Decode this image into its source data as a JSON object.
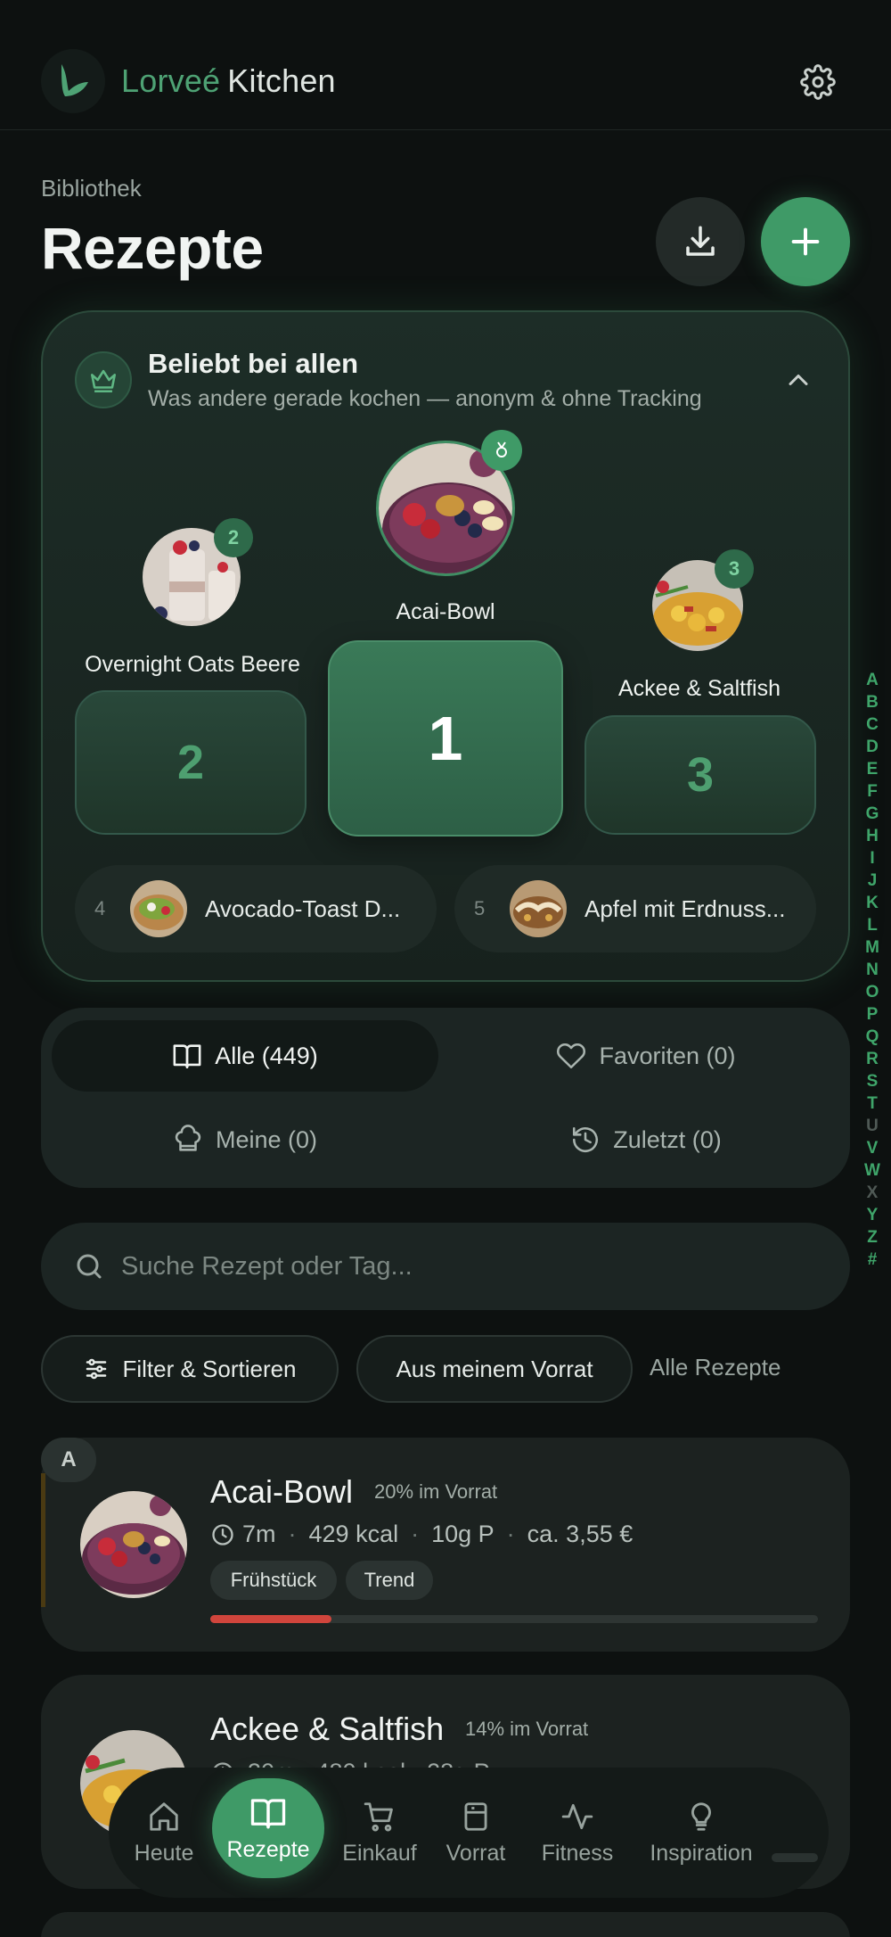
{
  "header": {
    "brand_part1": "Lorveé",
    "brand_part2": "Kitchen",
    "icons": {
      "logo": "leaf-logo-icon",
      "settings": "gear-icon"
    }
  },
  "page": {
    "eyebrow": "Bibliothek",
    "title": "Rezepte",
    "actions": {
      "download": "download-icon",
      "add": "plus-icon"
    }
  },
  "popular": {
    "title": "Beliebt bei allen",
    "subtitle": "Was andere gerade kochen — anonym & ohne Tracking",
    "podium": [
      {
        "rank": "1",
        "name": "Acai-Bowl"
      },
      {
        "rank": "2",
        "name": "Overnight Oats Beere"
      },
      {
        "rank": "3",
        "name": "Ackee & Saltfish"
      }
    ],
    "more": [
      {
        "rank": "4",
        "name": "Avocado-Toast D..."
      },
      {
        "rank": "5",
        "name": "Apfel mit Erdnuss..."
      }
    ]
  },
  "tabs": {
    "all": "Alle (449)",
    "favorites": "Favoriten (0)",
    "mine": "Meine (0)",
    "recent": "Zuletzt (0)"
  },
  "search": {
    "placeholder": "Suche Rezept oder Tag..."
  },
  "filters": {
    "filter_sort": "Filter & Sortieren",
    "from_stock": "Aus meinem Vorrat",
    "all_recipes": "Alle Rezepte"
  },
  "recipes": [
    {
      "letter": "A",
      "name": "Acai-Bowl",
      "stock": "20% im Vorrat",
      "time": "7m",
      "kcal": "429 kcal",
      "protein": "10g P",
      "price": "ca. 3,55 €",
      "tags": [
        "Frühstück",
        "Trend"
      ],
      "stock_fraction": 0.2
    },
    {
      "name": "Ackee & Saltfish",
      "stock": "14% im Vorrat",
      "meta_partial": "30m · 480 kcal · 28g P"
    }
  ],
  "alphabet": [
    "A",
    "B",
    "C",
    "D",
    "E",
    "F",
    "G",
    "H",
    "I",
    "J",
    "K",
    "L",
    "M",
    "N",
    "O",
    "P",
    "Q",
    "R",
    "S",
    "T",
    "U",
    "V",
    "W",
    "X",
    "Y",
    "Z",
    "#"
  ],
  "alphabet_dim": [
    "U",
    "X"
  ],
  "nav": {
    "home": "Heute",
    "recipes": "Rezepte",
    "shopping": "Einkauf",
    "pantry": "Vorrat",
    "fitness": "Fitness",
    "inspiration": "Inspiration"
  },
  "colors": {
    "accent": "#3f9a67",
    "background": "#0d1110",
    "progress_low": "#d0453c"
  }
}
